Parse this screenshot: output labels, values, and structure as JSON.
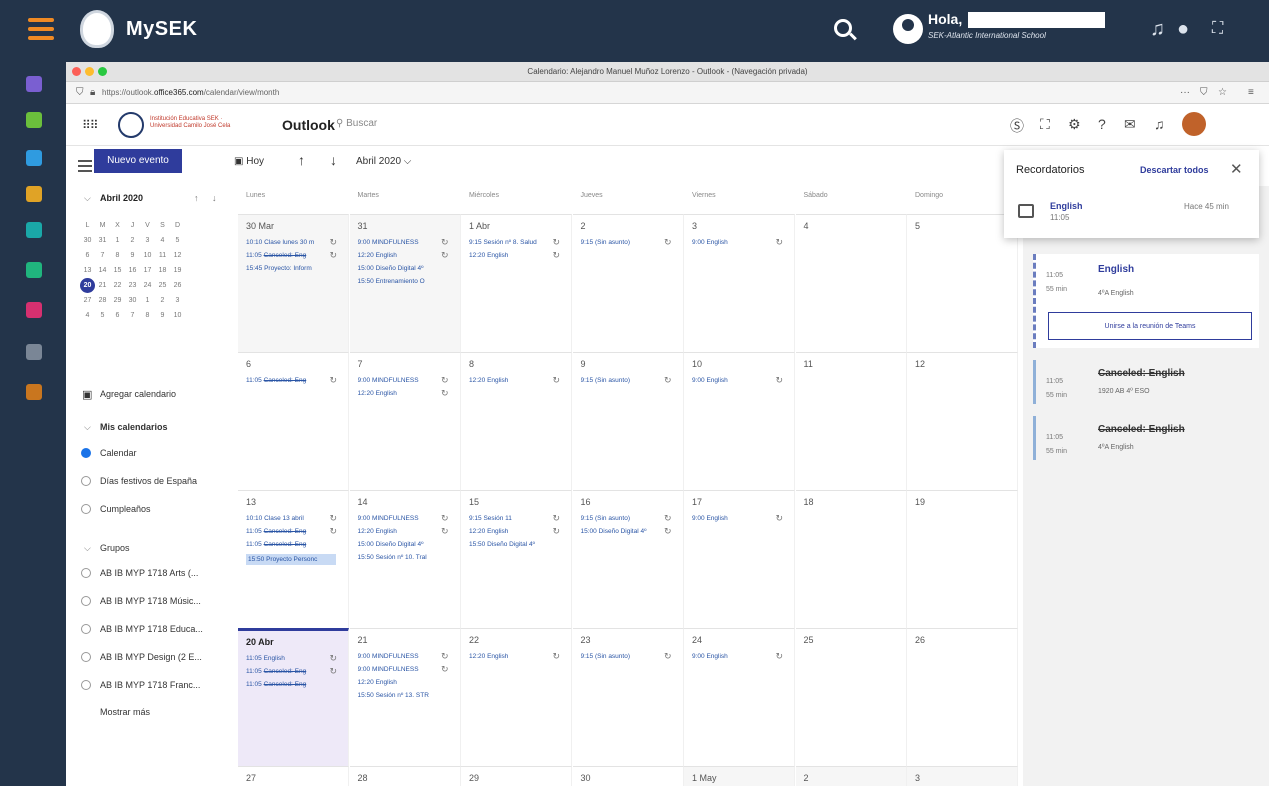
{
  "topbar": {
    "brand": "MySEK",
    "greeting": "Hola,",
    "school": "SEK-Atlantic International School"
  },
  "browser": {
    "title": "Calendario: Alejandro Manuel Muñoz Lorenzo - Outlook - (Navegación privada)",
    "url_prefix": "https://outlook.",
    "url_host": "office365.com",
    "url_path": "/calendar/view/month",
    "more": "···"
  },
  "outlook": {
    "org_text": "Institución Educativa SEK · Universidad Camilo José Cela",
    "app_name": "Outlook",
    "search_placeholder": "Buscar",
    "new_event": "Nuevo evento",
    "today": "Hoy",
    "month_label": "Abril 2020"
  },
  "mini_calendar": {
    "title": "Abril 2020",
    "weekdays": [
      "L",
      "M",
      "X",
      "J",
      "V",
      "S",
      "D"
    ],
    "weeks": [
      [
        "30",
        "31",
        "1",
        "2",
        "3",
        "4",
        "5"
      ],
      [
        "6",
        "7",
        "8",
        "9",
        "10",
        "11",
        "12"
      ],
      [
        "13",
        "14",
        "15",
        "16",
        "17",
        "18",
        "19"
      ],
      [
        "20",
        "21",
        "22",
        "23",
        "24",
        "25",
        "26"
      ],
      [
        "27",
        "28",
        "29",
        "30",
        "1",
        "2",
        "3"
      ],
      [
        "4",
        "5",
        "6",
        "7",
        "8",
        "9",
        "10"
      ]
    ],
    "today": "20"
  },
  "sidebar": {
    "add_calendar": "Agregar calendario",
    "my_calendars": "Mis calendarios",
    "calendars": [
      "Calendar",
      "Días festivos de España",
      "Cumpleaños"
    ],
    "groups_label": "Grupos",
    "groups": [
      "AB IB MYP 1718 Arts (...",
      "AB IB MYP 1718 Músic...",
      "AB IB MYP 1718 Educa...",
      "AB IB MYP Design (2 E...",
      "AB IB MYP 1718 Franc..."
    ],
    "show_more": "Mostrar más"
  },
  "day_headers": [
    "Lunes",
    "Martes",
    "Miércoles",
    "Jueves",
    "Viernes",
    "Sábado",
    "Domingo"
  ],
  "weeks": [
    {
      "days": [
        {
          "label": "30 Mar",
          "other": true,
          "events": [
            "10:10 Clase lunes 30 m",
            "11:05 Canceled: Eng",
            "15:45 Proyecto: Inform"
          ],
          "struck": [
            1
          ]
        },
        {
          "label": "31",
          "other": true,
          "events": [
            "9:00 MINDFULNESS",
            "12:20 English",
            "15:00 Diseño Digital 4º",
            "15:50 Entrenamiento O"
          ]
        },
        {
          "label": "1 Abr",
          "events": [
            "9:15 Sesión nº 8. Salud",
            "12:20 English"
          ]
        },
        {
          "label": "2",
          "events": [
            "9:15 (Sin asunto)"
          ]
        },
        {
          "label": "3",
          "events": [
            "9:00 English"
          ]
        },
        {
          "label": "4",
          "events": []
        },
        {
          "label": "5",
          "events": []
        }
      ]
    },
    {
      "days": [
        {
          "label": "6",
          "events": [
            "11:05 Canceled: Eng"
          ],
          "struck": [
            0
          ]
        },
        {
          "label": "7",
          "events": [
            "9:00 MINDFULNESS",
            "12:20 English"
          ]
        },
        {
          "label": "8",
          "events": [
            "12:20 English"
          ]
        },
        {
          "label": "9",
          "events": [
            "9:15 (Sin asunto)"
          ]
        },
        {
          "label": "10",
          "events": [
            "9:00 English"
          ]
        },
        {
          "label": "11",
          "events": []
        },
        {
          "label": "12",
          "events": []
        }
      ]
    },
    {
      "days": [
        {
          "label": "13",
          "events": [
            "10:10 Clase 13 abril",
            "11:05 Canceled: Eng",
            "11:05 Canceled: Eng",
            "15:50 Proyecto Personc"
          ],
          "struck": [
            1,
            2
          ],
          "selected": 3
        },
        {
          "label": "14",
          "events": [
            "9:00 MINDFULNESS",
            "12:20 English",
            "15:00 Diseño Digital 4º",
            "15:50 Sesión nº 10. Tral"
          ]
        },
        {
          "label": "15",
          "events": [
            "9:15 Sesión 11",
            "12:20 English",
            "15:50 Diseño Digital 4º"
          ]
        },
        {
          "label": "16",
          "events": [
            "9:15 (Sin asunto)",
            "15:00 Diseño Digital 4º"
          ]
        },
        {
          "label": "17",
          "events": [
            "9:00 English"
          ]
        },
        {
          "label": "18",
          "events": []
        },
        {
          "label": "19",
          "events": []
        }
      ]
    },
    {
      "days": [
        {
          "label": "20 Abr",
          "today": true,
          "events": [
            "11:05 English",
            "11:05 Canceled: Eng",
            "11:05 Canceled: Eng"
          ],
          "struck": [
            1,
            2
          ]
        },
        {
          "label": "21",
          "events": [
            "9:00 MINDFULNESS",
            "9:00 MINDFULNESS",
            "12:20 English",
            "15:50 Sesión nº 13. STR"
          ]
        },
        {
          "label": "22",
          "events": [
            "12:20 English"
          ]
        },
        {
          "label": "23",
          "events": [
            "9:15 (Sin asunto)"
          ]
        },
        {
          "label": "24",
          "events": [
            "9:00 English"
          ]
        },
        {
          "label": "25",
          "events": []
        },
        {
          "label": "26",
          "events": []
        }
      ]
    },
    {
      "days": [
        {
          "label": "27",
          "events": []
        },
        {
          "label": "28",
          "events": []
        },
        {
          "label": "29",
          "events": []
        },
        {
          "label": "30",
          "events": []
        },
        {
          "label": "1 May",
          "other": true,
          "events": []
        },
        {
          "label": "2",
          "other": true,
          "events": []
        },
        {
          "label": "3",
          "other": true,
          "events": []
        }
      ]
    }
  ],
  "reminders": {
    "title": "Recordatorios",
    "dismiss_all": "Descartar todos",
    "item_title": "English",
    "item_time": "11:05",
    "item_ago": "Hace 45 min"
  },
  "agenda": [
    {
      "time": "11:05",
      "duration": "55 min",
      "title": "English",
      "location": "4ºA English",
      "join": "Unirse a la reunión de Teams"
    },
    {
      "time": "11:05",
      "duration": "55 min",
      "title": "Canceled: English",
      "location": "1920 AB 4º ESO"
    },
    {
      "time": "11:05",
      "duration": "55 min",
      "title": "Canceled: English",
      "location": "4ºA English"
    }
  ]
}
